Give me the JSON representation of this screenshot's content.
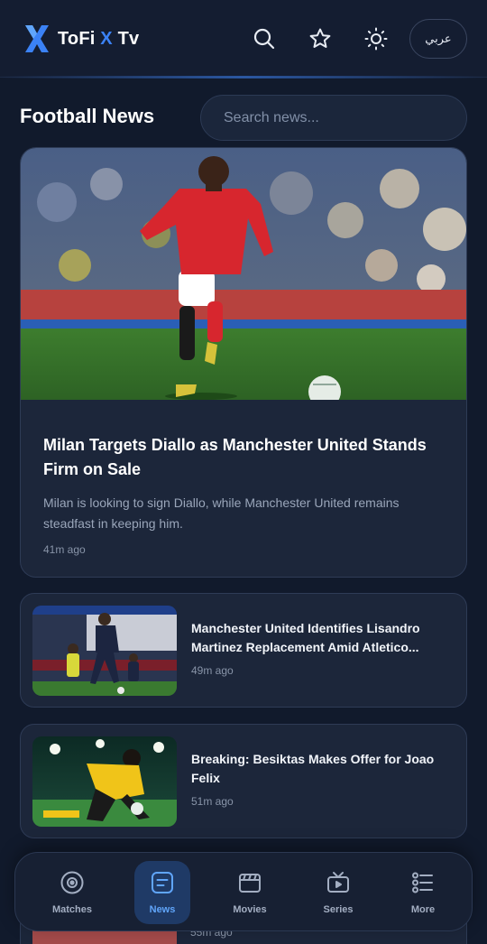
{
  "header": {
    "logo_prefix": "ToFi ",
    "logo_x": "X",
    "logo_suffix": " Tv",
    "lang_label": "عربي",
    "icons": [
      "search-icon",
      "star-icon",
      "sun-icon"
    ],
    "accent_color": "#3b82f6"
  },
  "page": {
    "title": "Football News",
    "search_placeholder": "Search news..."
  },
  "featured": {
    "title": "Milan Targets Diallo as Manchester United Stands Firm on Sale",
    "description": "Milan is looking to sign Diallo, while Manchester United remains steadfast in keeping him.",
    "time": "41m ago"
  },
  "articles": [
    {
      "title": "Manchester United Identifies Lisandro Martinez Replacement Amid Atletico...",
      "time": "49m ago"
    },
    {
      "title": "Breaking: Besiktas Makes Offer for Joao Felix",
      "time": "51m ago"
    },
    {
      "time": "55m ago"
    }
  ],
  "nav": {
    "items": [
      {
        "label": "Matches",
        "icon": "football-icon"
      },
      {
        "label": "News",
        "icon": "news-icon",
        "active": true
      },
      {
        "label": "Movies",
        "icon": "clapperboard-icon"
      },
      {
        "label": "Series",
        "icon": "tv-icon"
      },
      {
        "label": "More",
        "icon": "list-icon"
      }
    ],
    "active_color": "#60a5fa"
  }
}
